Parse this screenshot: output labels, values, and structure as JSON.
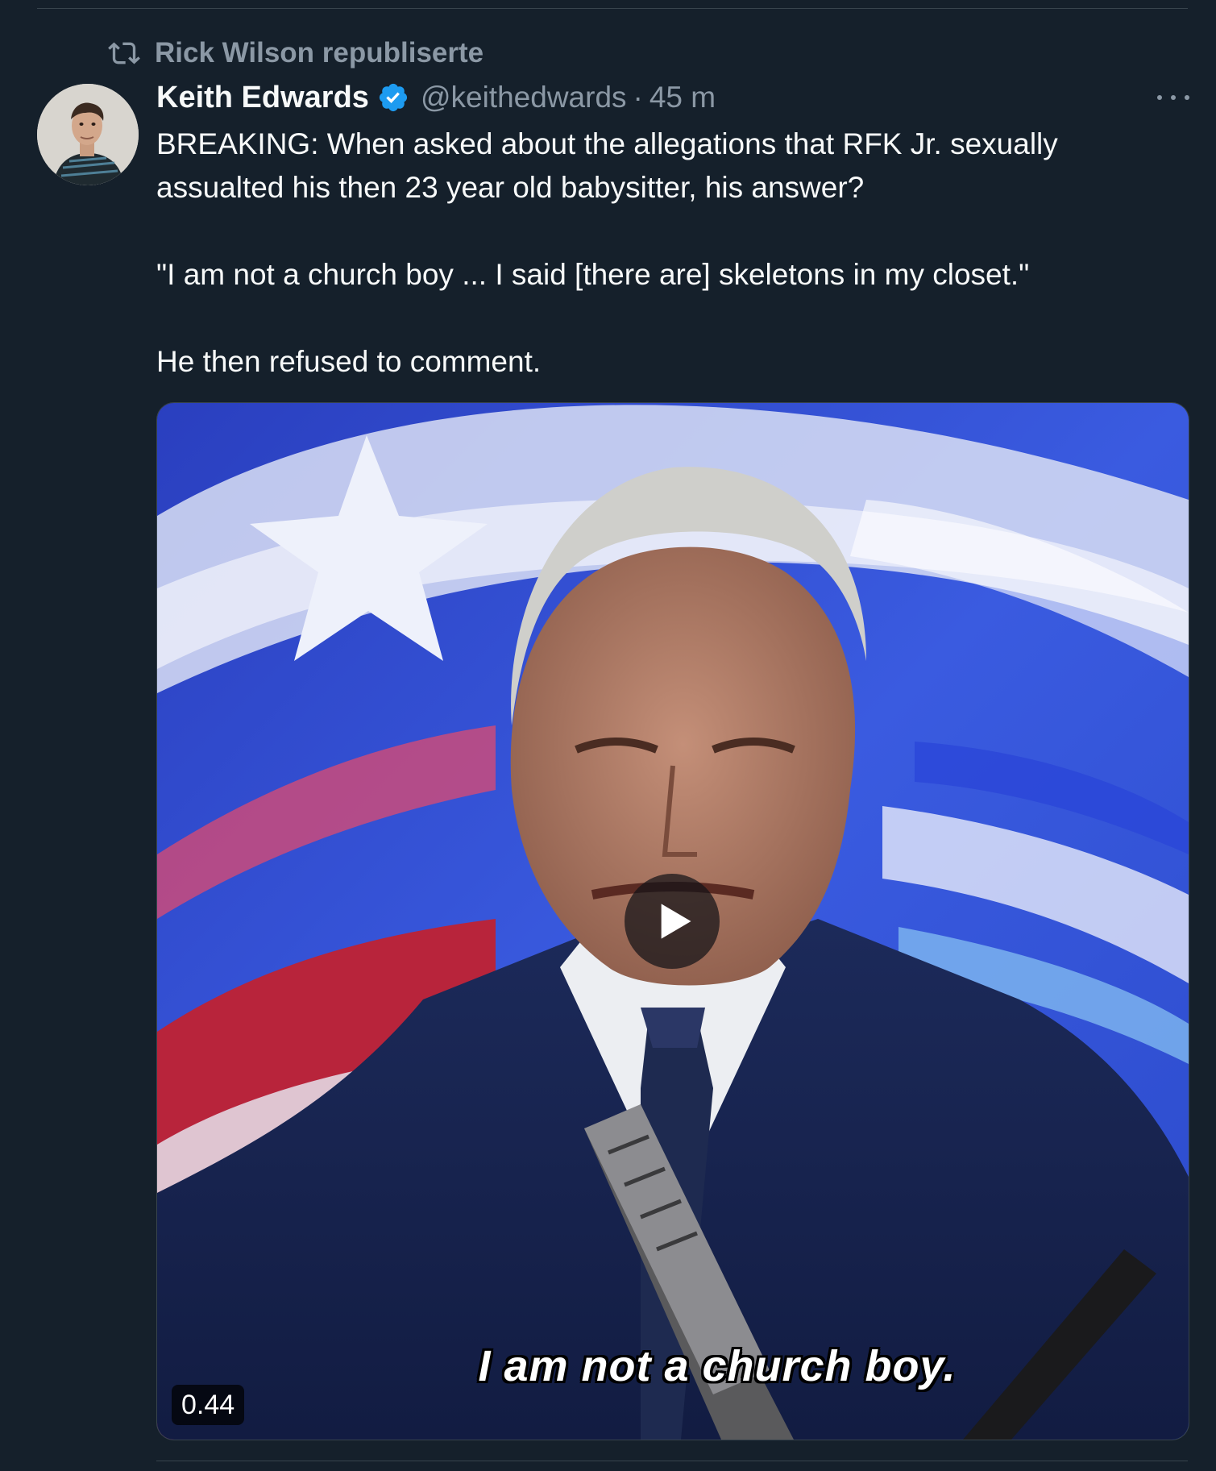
{
  "repost": {
    "label": "Rick Wilson republiserte",
    "icon": "repost-icon"
  },
  "tweet": {
    "author": {
      "display_name": "Keith Edwards",
      "handle": "@keithedwards",
      "verified": true,
      "verified_icon": "verified-badge-icon"
    },
    "separator": "·",
    "timestamp": "45 m",
    "more_icon": "more-options-icon",
    "text": {
      "paragraph_1": "BREAKING: When asked about the allegations that RFK Jr. sexually assualted his then 23 year old babysitter, his answer?",
      "paragraph_2": "\"I am not a church boy ... I said [there are] skeletons in my closet.\"",
      "paragraph_3": "He then refused to comment."
    },
    "media": {
      "type": "video",
      "caption": "I am not a church boy.",
      "duration": "0.44",
      "play_icon": "play-icon"
    }
  },
  "colors": {
    "background": "#15202b",
    "primary_text": "#f7f9f9",
    "secondary_text": "#8b98a5",
    "verified_blue": "#1d9bf0",
    "divider": "#38444d"
  }
}
